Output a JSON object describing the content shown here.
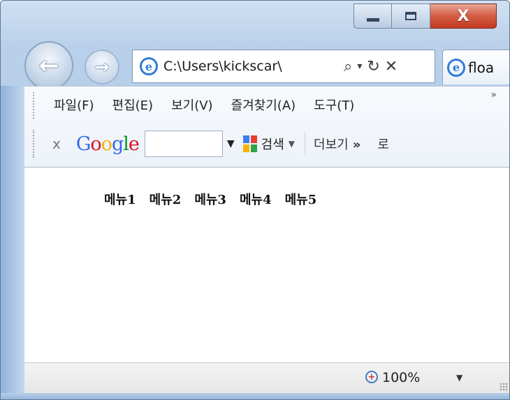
{
  "window": {
    "caption": {
      "minimize": "–",
      "maximize": "□",
      "close": "X"
    }
  },
  "nav": {
    "back_icon": "back-arrow",
    "forward_icon": "forward-arrow",
    "address": "C:\\Users\\kickscar\\",
    "address_search_icon": "⌕",
    "address_dropdown": "▾",
    "address_refresh": "↻",
    "address_stop": "✕",
    "tab_title": "floa"
  },
  "menubar": {
    "items": [
      "파일(F)",
      "편집(E)",
      "보기(V)",
      "즐겨찾기(A)",
      "도구(T)"
    ],
    "overflow": "»"
  },
  "googlebar": {
    "close": "x",
    "logo_letters": [
      "G",
      "o",
      "o",
      "g",
      "l",
      "e"
    ],
    "logo_colors": [
      "#3369e8",
      "#d50f25",
      "#eeb211",
      "#3369e8",
      "#009925",
      "#d50f25"
    ],
    "search_value": "",
    "search_label": "검색",
    "more_label": "더보기",
    "more_chevron": "»",
    "cut_label": "로"
  },
  "content": {
    "menus": [
      "메뉴1",
      "메뉴2",
      "메뉴3",
      "메뉴4",
      "메뉴5"
    ]
  },
  "status": {
    "zoom": "100%"
  }
}
